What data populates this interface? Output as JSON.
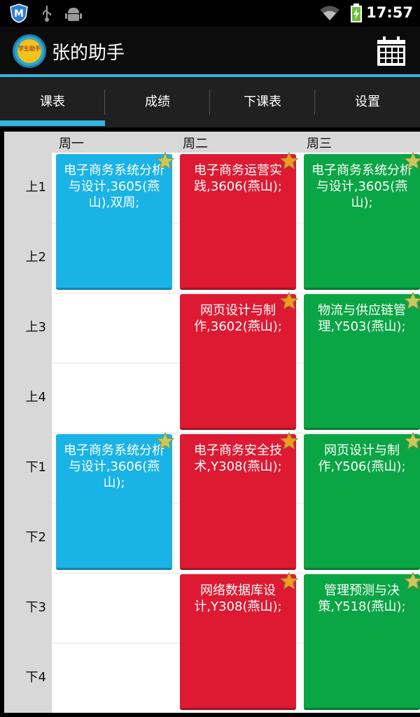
{
  "status_bar": {
    "time": "17:57",
    "icons": [
      "m-shield-icon",
      "usb-icon",
      "android-debug-icon",
      "wifi-icon",
      "battery-charging-icon"
    ]
  },
  "action_bar": {
    "logo_text": "学生助手",
    "title": "张的助手",
    "calendar_icon": "calendar-icon"
  },
  "tabs": [
    {
      "label": "课表",
      "selected": true
    },
    {
      "label": "成绩",
      "selected": false
    },
    {
      "label": "下课表",
      "selected": false
    },
    {
      "label": "设置",
      "selected": false
    }
  ],
  "timetable": {
    "days": [
      "周一",
      "周二",
      "周三"
    ],
    "periods": [
      "上1",
      "上2",
      "上3",
      "上4",
      "下1",
      "下2",
      "下3",
      "下4"
    ],
    "courses": [
      {
        "day": 0,
        "start": 0,
        "span": 2,
        "color": "#1ab3e6",
        "text": "电子商务系统分析与设计,3605(燕山),双周;"
      },
      {
        "day": 1,
        "start": 0,
        "span": 2,
        "color": "#dd1a32",
        "text": "电子商务运营实践,3606(燕山);"
      },
      {
        "day": 2,
        "start": 0,
        "span": 2,
        "color": "#0aa544",
        "text": "电子商务系统分析与设计,3605(燕山);"
      },
      {
        "day": 1,
        "start": 2,
        "span": 2,
        "color": "#dd1a32",
        "text": "网页设计与制作,3602(燕山);"
      },
      {
        "day": 2,
        "start": 2,
        "span": 2,
        "color": "#0aa544",
        "text": "物流与供应链管理,Y503(燕山);"
      },
      {
        "day": 0,
        "start": 4,
        "span": 2,
        "color": "#1ab3e6",
        "text": "电子商务系统分析与设计,3606(燕山);"
      },
      {
        "day": 1,
        "start": 4,
        "span": 2,
        "color": "#dd1a32",
        "text": "电子商务安全技术,Y308(燕山);"
      },
      {
        "day": 2,
        "start": 4,
        "span": 2,
        "color": "#0aa544",
        "text": "网页设计与制作,Y506(燕山);"
      },
      {
        "day": 1,
        "start": 6,
        "span": 2,
        "color": "#dd1a32",
        "text": "网络数据库设计,Y308(燕山);"
      },
      {
        "day": 2,
        "start": 6,
        "span": 2,
        "color": "#0aa544",
        "text": "管理预测与决策,Y518(燕山);"
      }
    ]
  }
}
